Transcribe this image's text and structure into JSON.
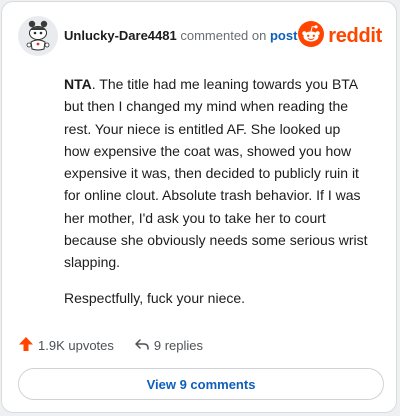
{
  "comment": {
    "username": "Unlucky-Dare4481",
    "commented_on": "commented on",
    "post_link": "post",
    "lead": "NTA",
    "paragraph_1_rest": ". The title had me leaning towards you BTA but then I changed my mind when reading the rest. Your niece is entitled AF. She looked up how expensive the coat was, showed you how expensive it was, then decided to publicly ruin it for online clout. Absolute trash behavior. If I was her mother, I'd ask you to take her to court because she obviously needs some serious wrist slapping.",
    "paragraph_2": "Respectfully, fuck your niece."
  },
  "brand": {
    "wordmark": "reddit",
    "color": "#ff4500"
  },
  "actions": {
    "upvotes": "1.9K upvotes",
    "replies": "9 replies"
  },
  "view_comments_label": "View 9 comments",
  "icons": {
    "avatar": "snoo-avatar-icon",
    "brand": "reddit-logo-icon",
    "upvote": "upvote-arrow-icon",
    "reply": "reply-arrow-icon"
  },
  "colors": {
    "accent_orange": "#ff4500",
    "link_blue": "#0f5fba",
    "text": "#1c1c1c",
    "muted": "#6a6e72"
  }
}
